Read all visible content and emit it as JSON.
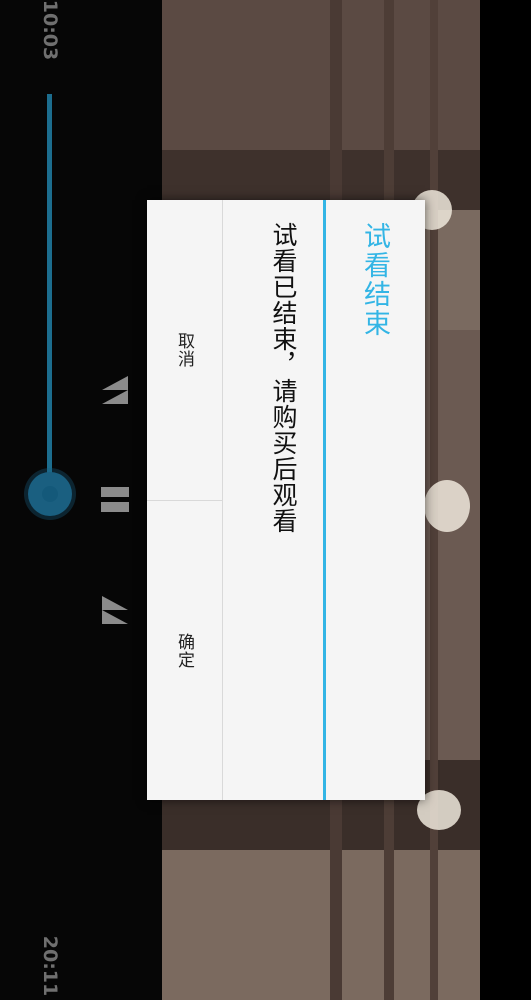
{
  "player": {
    "current_time": "10:03",
    "total_time": "20:11",
    "progress_fraction": 0.5
  },
  "dialog": {
    "title": "试看结束",
    "message": "试看已结束，请购买后观看",
    "cancel_label": "取消",
    "confirm_label": "确定"
  },
  "colors": {
    "accent": "#33b5e5",
    "seekbar": "#1c6d8e",
    "dialog_bg": "#f5f5f5"
  },
  "icons": [
    "rewind-icon",
    "pause-icon",
    "fast-forward-icon"
  ]
}
